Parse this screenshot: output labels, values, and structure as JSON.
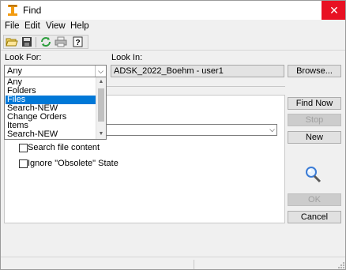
{
  "window": {
    "title": "Find"
  },
  "menu": {
    "items": [
      "File",
      "Edit",
      "View",
      "Help"
    ]
  },
  "toolbar": {
    "icons": [
      "open-folder-icon",
      "save-icon",
      "refresh-icon",
      "print-icon",
      "help-icon"
    ]
  },
  "look_for": {
    "label": "Look For:",
    "value": "Any",
    "options": [
      "Any",
      "Folders",
      "Files",
      "Search-NEW",
      "Change Orders",
      "Items",
      "Search-NEW"
    ],
    "selected_index": 2
  },
  "look_in": {
    "label": "Look In:",
    "value": "ADSK_2022_Boehm - user1"
  },
  "buttons": {
    "browse": "Browse...",
    "find_now": "Find Now",
    "stop": "Stop",
    "new": "New",
    "ok": "OK",
    "cancel": "Cancel"
  },
  "options": {
    "search_file_content": "Search file content",
    "ignore_obsolete": "Ignore \"Obsolete\" State"
  },
  "colors": {
    "close": "#e81123",
    "selection": "#0078d7"
  }
}
